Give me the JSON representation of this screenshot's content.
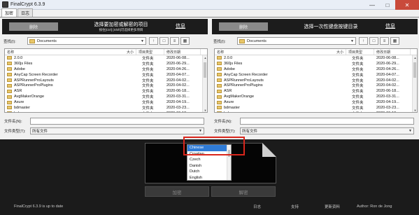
{
  "window": {
    "title": "FinalCrypt 6.3.9"
  },
  "tabs": [
    {
      "label": "加密"
    },
    {
      "label": "日志"
    }
  ],
  "left_pane": {
    "button": "删除",
    "title": "选择要加密或解密的项目",
    "subtitle": "按住[Ctrl] [Shift]可选择更多项目",
    "info": "信息",
    "look_in_label": "查找(I):",
    "look_in_value": "Documents",
    "columns": {
      "name": "名称",
      "size": "大小",
      "type": "项目类型",
      "date": "修改日期"
    },
    "files": [
      {
        "name": "2.0.0",
        "type": "文件夹",
        "date": "2020-06-08..."
      },
      {
        "name": "360js Files",
        "type": "文件夹",
        "date": "2020-06-29..."
      },
      {
        "name": "Adobe",
        "type": "文件夹",
        "date": "2020-04-26..."
      },
      {
        "name": "AnyCap Screen Recorder",
        "type": "文件夹",
        "date": "2020-04-07..."
      },
      {
        "name": "ASPRunnerProLayouts",
        "type": "文件夹",
        "date": "2020-04-02..."
      },
      {
        "name": "ASPRunnerProPlugins",
        "type": "文件夹",
        "date": "2020-04-02..."
      },
      {
        "name": "ASR",
        "type": "文件夹",
        "date": "2020-06-18..."
      },
      {
        "name": "AvgMakerOrange",
        "type": "文件夹",
        "date": "2020-03-31..."
      },
      {
        "name": "Axure",
        "type": "文件夹",
        "date": "2020-04-19..."
      },
      {
        "name": "bdmaster",
        "type": "文件夹",
        "date": "2020-03-23..."
      },
      {
        "name": "bokecc",
        "type": "文件夹",
        "date": "2020-06-18..."
      }
    ],
    "filename_label": "文件名(N):",
    "filename_value": "",
    "filetype_label": "文件类型(T):",
    "filetype_value": "所有文件"
  },
  "right_pane": {
    "button": "删除",
    "title": "选择一次性键盘按键目录",
    "info": "信息",
    "look_in_label": "查找(I):",
    "look_in_value": "Documents",
    "columns": {
      "name": "名称",
      "size": "大小",
      "type": "项目类型",
      "date": "修改日期"
    },
    "files": [
      {
        "name": "2.0.0",
        "type": "文件夹",
        "date": "2020-06-08..."
      },
      {
        "name": "360js Files",
        "type": "文件夹",
        "date": "2020-06-29..."
      },
      {
        "name": "Adobe",
        "type": "文件夹",
        "date": "2020-04-26..."
      },
      {
        "name": "AnyCap Screen Recorder",
        "type": "文件夹",
        "date": "2020-04-07..."
      },
      {
        "name": "ASPRunnerProLayouts",
        "type": "文件夹",
        "date": "2020-04-02..."
      },
      {
        "name": "ASPRunnerProPlugins",
        "type": "文件夹",
        "date": "2020-04-02..."
      },
      {
        "name": "ASR",
        "type": "文件夹",
        "date": "2020-06-18..."
      },
      {
        "name": "AvgMakerOrange",
        "type": "文件夹",
        "date": "2020-03-31..."
      },
      {
        "name": "Axure",
        "type": "文件夹",
        "date": "2020-04-19..."
      },
      {
        "name": "bdmaster",
        "type": "文件夹",
        "date": "2020-03-23..."
      },
      {
        "name": "bokecc",
        "type": "文件夹",
        "date": "2020-06-18..."
      }
    ],
    "filename_label": "文件名(N):",
    "filename_value": "",
    "filetype_label": "文件类型(T):",
    "filetype_value": "所有文件"
  },
  "drop_panel": {
    "text": "选 录"
  },
  "language_dropdown": {
    "options": [
      "Chinese",
      "Croatian",
      "Czech",
      "Danish",
      "Dutch",
      "English"
    ],
    "selected": "Chinese"
  },
  "actions": {
    "encrypt": "加密",
    "decrypt": "解密"
  },
  "status_bar": {
    "message": "FinalCrypt 6.3.9 is up to date",
    "log": "日志",
    "support": "支持",
    "update": "更新资料",
    "author": "Author: Ron de Jong"
  },
  "colors": {
    "highlight": "#d9261c",
    "selection": "#2f7bd6"
  }
}
